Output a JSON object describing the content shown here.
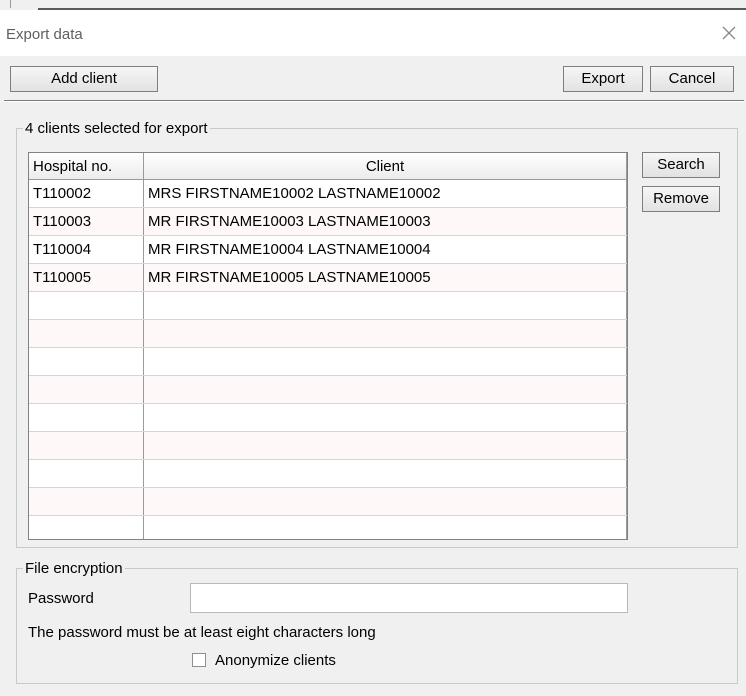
{
  "window": {
    "title": "Export data",
    "close_icon": "close-icon"
  },
  "toolbar": {
    "add_client_label": "Add client",
    "export_label": "Export",
    "cancel_label": "Cancel"
  },
  "clients_group": {
    "legend": "4 clients selected for export",
    "columns": [
      "Hospital no.",
      "Client"
    ],
    "rows": [
      [
        "T110002",
        "MRS FIRSTNAME10002 LASTNAME10002"
      ],
      [
        "T110003",
        "MR FIRSTNAME10003 LASTNAME10003"
      ],
      [
        "T110004",
        "MR FIRSTNAME10004 LASTNAME10004"
      ],
      [
        "T110005",
        "MR FIRSTNAME10005 LASTNAME10005"
      ]
    ],
    "empty_row_count": 9,
    "search_label": "Search",
    "remove_label": "Remove"
  },
  "encryption_group": {
    "legend": "File encryption",
    "password_label": "Password",
    "password_value": "",
    "hint": "The password must be at least eight characters long",
    "anonymize_label": "Anonymize clients",
    "anonymize_checked": false
  },
  "colors": {
    "background": "#f0f0f0",
    "titlebar": "#ffffff",
    "row_tint": "#fff8f8",
    "grid_line": "#9a9a9a"
  }
}
